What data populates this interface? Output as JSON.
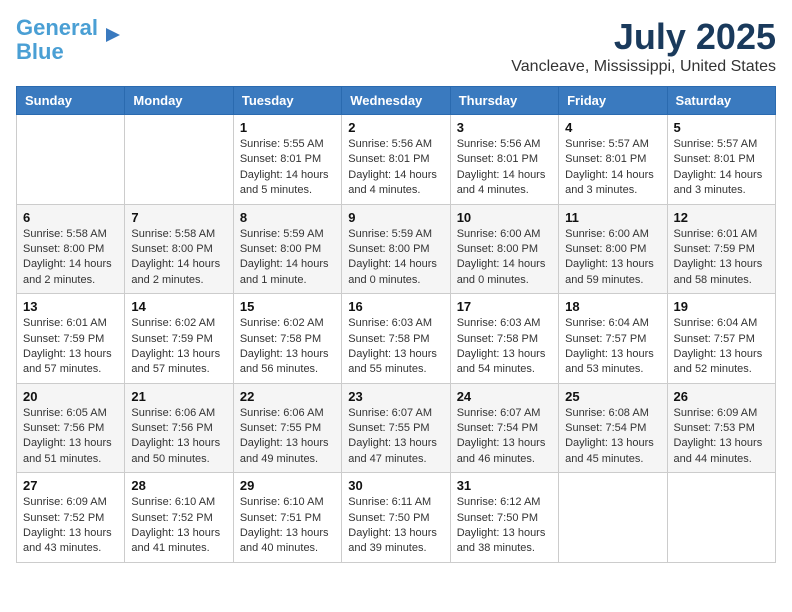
{
  "header": {
    "logo_line1": "General",
    "logo_line2": "Blue",
    "title": "July 2025",
    "subtitle": "Vancleave, Mississippi, United States"
  },
  "days_of_week": [
    "Sunday",
    "Monday",
    "Tuesday",
    "Wednesday",
    "Thursday",
    "Friday",
    "Saturday"
  ],
  "weeks": [
    [
      {
        "day": "",
        "info": ""
      },
      {
        "day": "",
        "info": ""
      },
      {
        "day": "1",
        "info": "Sunrise: 5:55 AM\nSunset: 8:01 PM\nDaylight: 14 hours\nand 5 minutes."
      },
      {
        "day": "2",
        "info": "Sunrise: 5:56 AM\nSunset: 8:01 PM\nDaylight: 14 hours\nand 4 minutes."
      },
      {
        "day": "3",
        "info": "Sunrise: 5:56 AM\nSunset: 8:01 PM\nDaylight: 14 hours\nand 4 minutes."
      },
      {
        "day": "4",
        "info": "Sunrise: 5:57 AM\nSunset: 8:01 PM\nDaylight: 14 hours\nand 3 minutes."
      },
      {
        "day": "5",
        "info": "Sunrise: 5:57 AM\nSunset: 8:01 PM\nDaylight: 14 hours\nand 3 minutes."
      }
    ],
    [
      {
        "day": "6",
        "info": "Sunrise: 5:58 AM\nSunset: 8:00 PM\nDaylight: 14 hours\nand 2 minutes."
      },
      {
        "day": "7",
        "info": "Sunrise: 5:58 AM\nSunset: 8:00 PM\nDaylight: 14 hours\nand 2 minutes."
      },
      {
        "day": "8",
        "info": "Sunrise: 5:59 AM\nSunset: 8:00 PM\nDaylight: 14 hours\nand 1 minute."
      },
      {
        "day": "9",
        "info": "Sunrise: 5:59 AM\nSunset: 8:00 PM\nDaylight: 14 hours\nand 0 minutes."
      },
      {
        "day": "10",
        "info": "Sunrise: 6:00 AM\nSunset: 8:00 PM\nDaylight: 14 hours\nand 0 minutes."
      },
      {
        "day": "11",
        "info": "Sunrise: 6:00 AM\nSunset: 8:00 PM\nDaylight: 13 hours\nand 59 minutes."
      },
      {
        "day": "12",
        "info": "Sunrise: 6:01 AM\nSunset: 7:59 PM\nDaylight: 13 hours\nand 58 minutes."
      }
    ],
    [
      {
        "day": "13",
        "info": "Sunrise: 6:01 AM\nSunset: 7:59 PM\nDaylight: 13 hours\nand 57 minutes."
      },
      {
        "day": "14",
        "info": "Sunrise: 6:02 AM\nSunset: 7:59 PM\nDaylight: 13 hours\nand 57 minutes."
      },
      {
        "day": "15",
        "info": "Sunrise: 6:02 AM\nSunset: 7:58 PM\nDaylight: 13 hours\nand 56 minutes."
      },
      {
        "day": "16",
        "info": "Sunrise: 6:03 AM\nSunset: 7:58 PM\nDaylight: 13 hours\nand 55 minutes."
      },
      {
        "day": "17",
        "info": "Sunrise: 6:03 AM\nSunset: 7:58 PM\nDaylight: 13 hours\nand 54 minutes."
      },
      {
        "day": "18",
        "info": "Sunrise: 6:04 AM\nSunset: 7:57 PM\nDaylight: 13 hours\nand 53 minutes."
      },
      {
        "day": "19",
        "info": "Sunrise: 6:04 AM\nSunset: 7:57 PM\nDaylight: 13 hours\nand 52 minutes."
      }
    ],
    [
      {
        "day": "20",
        "info": "Sunrise: 6:05 AM\nSunset: 7:56 PM\nDaylight: 13 hours\nand 51 minutes."
      },
      {
        "day": "21",
        "info": "Sunrise: 6:06 AM\nSunset: 7:56 PM\nDaylight: 13 hours\nand 50 minutes."
      },
      {
        "day": "22",
        "info": "Sunrise: 6:06 AM\nSunset: 7:55 PM\nDaylight: 13 hours\nand 49 minutes."
      },
      {
        "day": "23",
        "info": "Sunrise: 6:07 AM\nSunset: 7:55 PM\nDaylight: 13 hours\nand 47 minutes."
      },
      {
        "day": "24",
        "info": "Sunrise: 6:07 AM\nSunset: 7:54 PM\nDaylight: 13 hours\nand 46 minutes."
      },
      {
        "day": "25",
        "info": "Sunrise: 6:08 AM\nSunset: 7:54 PM\nDaylight: 13 hours\nand 45 minutes."
      },
      {
        "day": "26",
        "info": "Sunrise: 6:09 AM\nSunset: 7:53 PM\nDaylight: 13 hours\nand 44 minutes."
      }
    ],
    [
      {
        "day": "27",
        "info": "Sunrise: 6:09 AM\nSunset: 7:52 PM\nDaylight: 13 hours\nand 43 minutes."
      },
      {
        "day": "28",
        "info": "Sunrise: 6:10 AM\nSunset: 7:52 PM\nDaylight: 13 hours\nand 41 minutes."
      },
      {
        "day": "29",
        "info": "Sunrise: 6:10 AM\nSunset: 7:51 PM\nDaylight: 13 hours\nand 40 minutes."
      },
      {
        "day": "30",
        "info": "Sunrise: 6:11 AM\nSunset: 7:50 PM\nDaylight: 13 hours\nand 39 minutes."
      },
      {
        "day": "31",
        "info": "Sunrise: 6:12 AM\nSunset: 7:50 PM\nDaylight: 13 hours\nand 38 minutes."
      },
      {
        "day": "",
        "info": ""
      },
      {
        "day": "",
        "info": ""
      }
    ]
  ]
}
